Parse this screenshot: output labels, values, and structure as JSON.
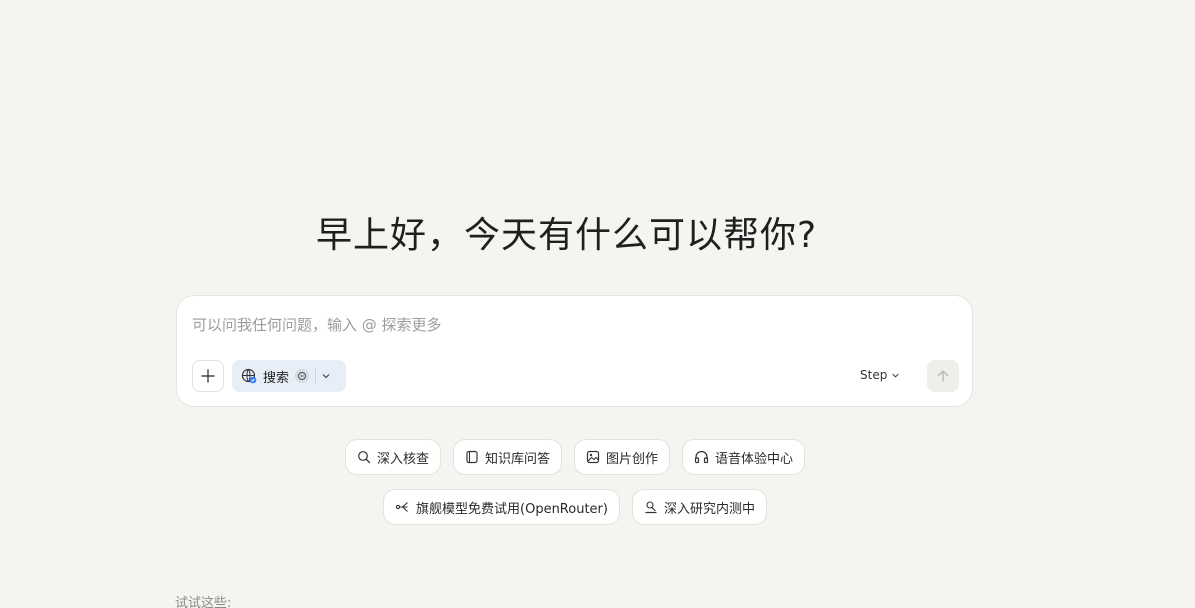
{
  "greeting": "早上好，今天有什么可以帮你?",
  "composer": {
    "placeholder": "可以问我任何问题，输入 @ 探索更多",
    "value": "",
    "search_label": "搜索",
    "model_label": "Step"
  },
  "quick_actions_row1": [
    {
      "label": "深入核查",
      "icon": "magnifier-check-icon"
    },
    {
      "label": "知识库问答",
      "icon": "knowledge-base-icon"
    },
    {
      "label": "图片创作",
      "icon": "image-icon"
    },
    {
      "label": "语音体验中心",
      "icon": "headphones-icon"
    }
  ],
  "quick_actions_row2": [
    {
      "label": "旗舰模型免费试用(OpenRouter)",
      "icon": "router-icon"
    },
    {
      "label": "深入研究内测中",
      "icon": "research-icon"
    }
  ],
  "try_label": "试试这些:",
  "colors": {
    "background": "#f5f4f0",
    "search_pill": "#e7eef7",
    "card": "#ffffff"
  }
}
